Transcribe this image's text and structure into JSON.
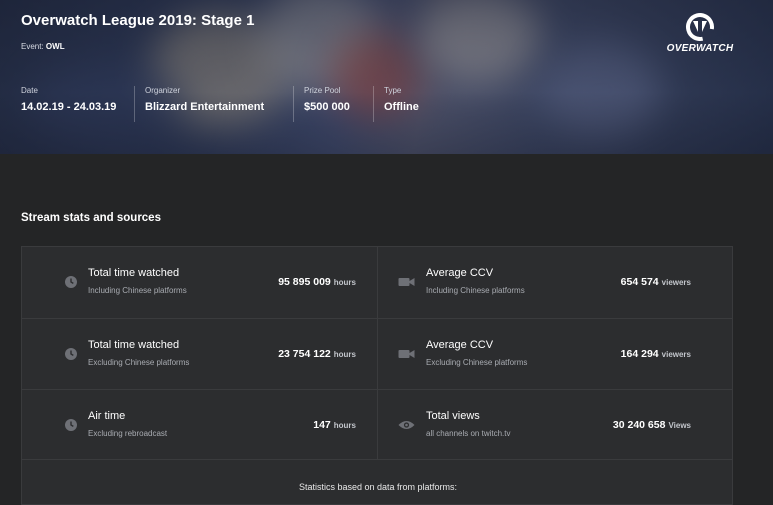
{
  "header": {
    "title": "Overwatch League 2019: Stage 1",
    "event_label": "Event:",
    "event_value": "OWL",
    "logo_text": "OVERWATCH",
    "meta": [
      {
        "label": "Date",
        "value": "14.02.19 - 24.03.19"
      },
      {
        "label": "Organizer",
        "value": "Blizzard Entertainment"
      },
      {
        "label": "Prize Pool",
        "value": "$500 000"
      },
      {
        "label": "Type",
        "value": "Offline"
      }
    ]
  },
  "section": {
    "title": "Stream stats and sources",
    "stats": [
      {
        "name": "Total time watched",
        "sub": "Including Chinese platforms",
        "value": "95 895 009",
        "unit": "hours",
        "icon": "clock-icon"
      },
      {
        "name": "Average CCV",
        "sub": "Including Chinese platforms",
        "value": "654 574",
        "unit": "viewers",
        "icon": "video-camera-icon"
      },
      {
        "name": "Total time watched",
        "sub": "Excluding Chinese platforms",
        "value": "23 754 122",
        "unit": "hours",
        "icon": "clock-icon"
      },
      {
        "name": "Average CCV",
        "sub": "Excluding Chinese platforms",
        "value": "164 294",
        "unit": "viewers",
        "icon": "video-camera-icon"
      },
      {
        "name": "Air time",
        "sub": "Excluding rebroadcast",
        "value": "147",
        "unit": "hours",
        "icon": "clock-icon"
      },
      {
        "name": "Total views",
        "sub": "all channels on twitch.tv",
        "value": "30 240 658",
        "unit": "Views",
        "icon": "eye-icon"
      }
    ],
    "footnote": "Statistics based on data from platforms:"
  },
  "colors": {
    "background": "#242526",
    "panel": "#2c2d2f",
    "border": "#3a3b3d",
    "muted": "#a9acb2"
  }
}
